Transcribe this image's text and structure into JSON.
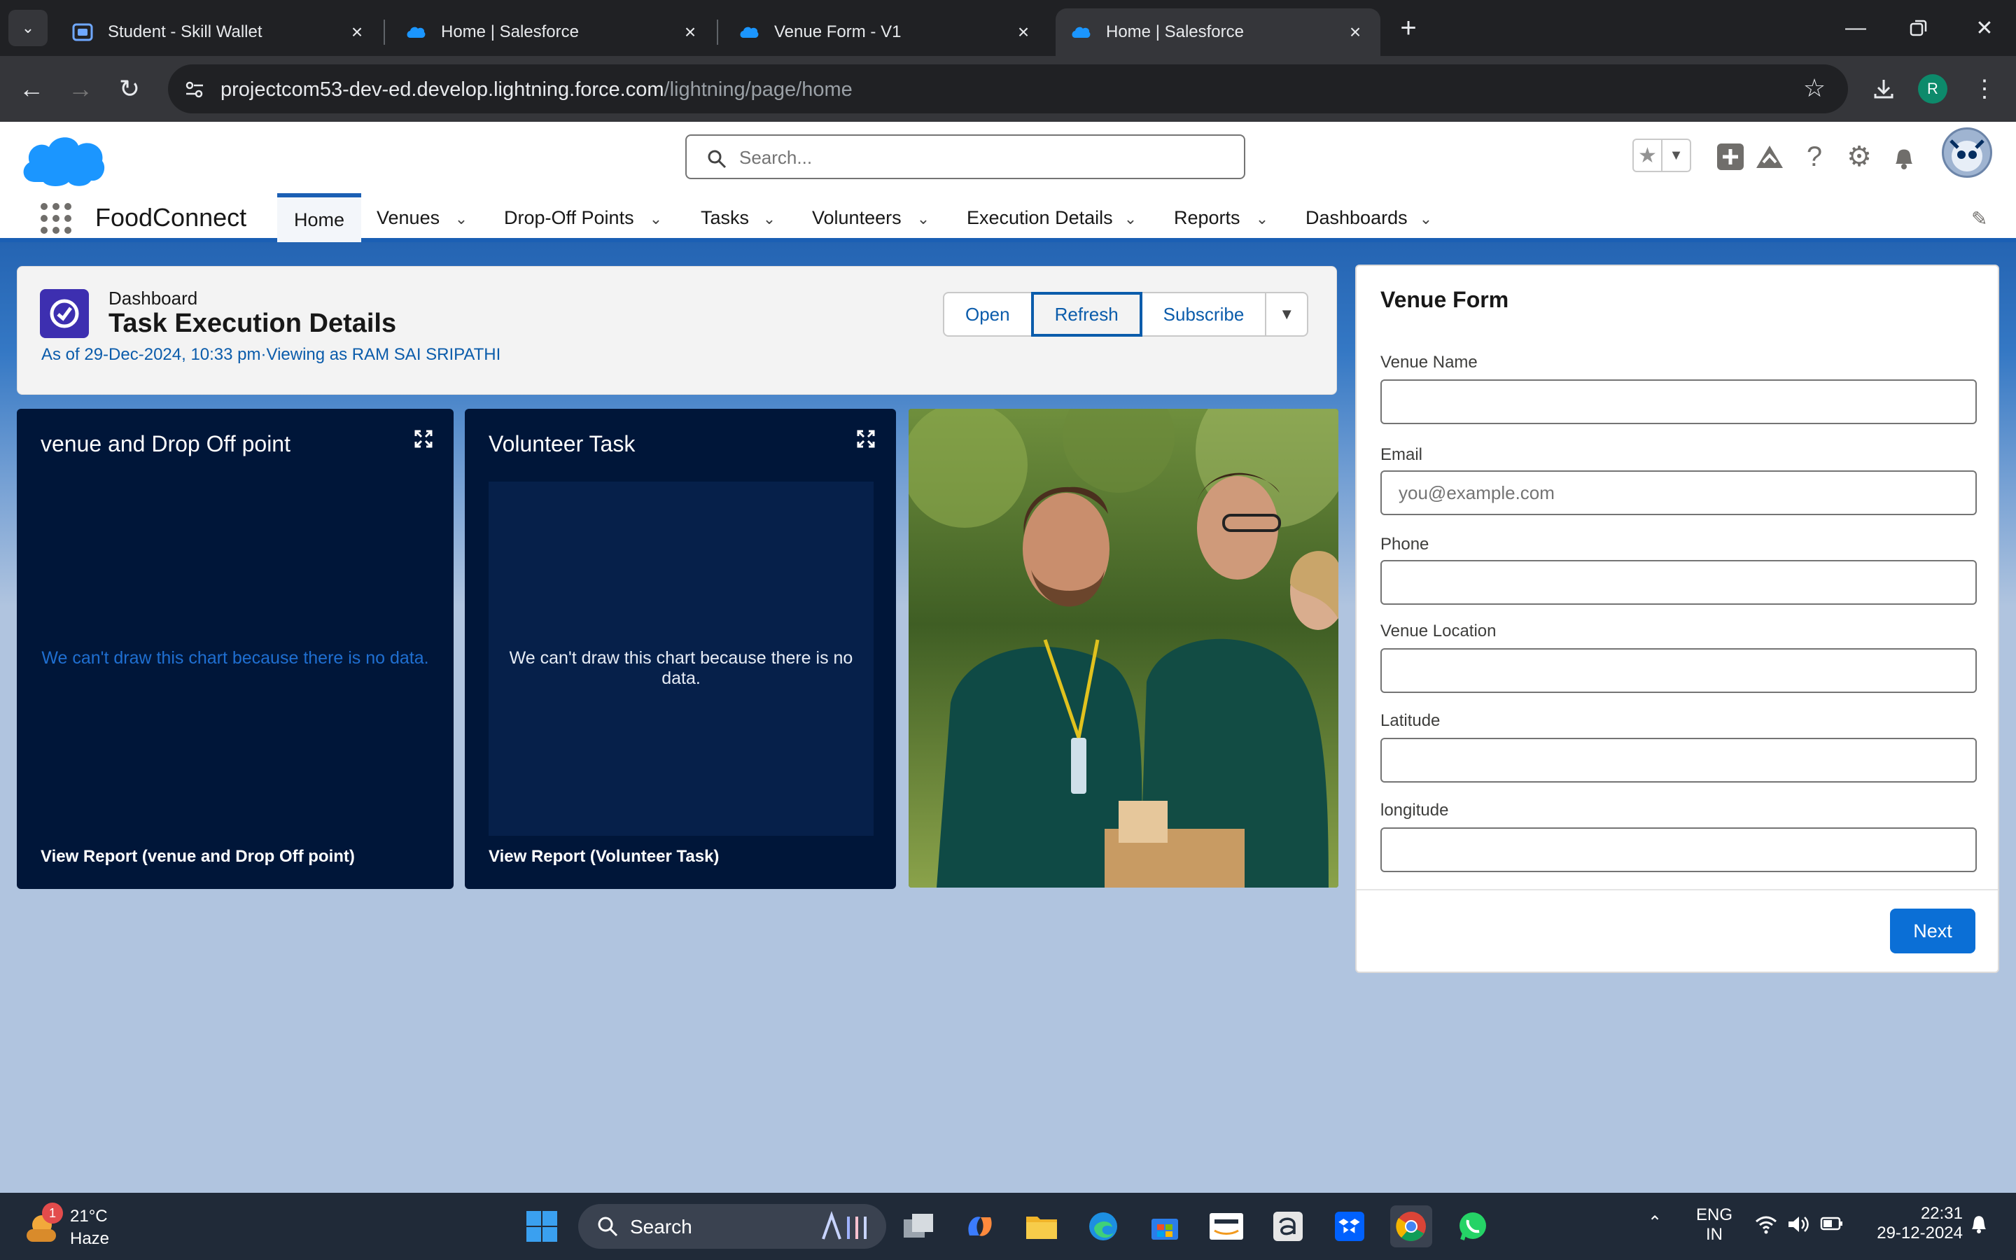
{
  "browser": {
    "tabs": [
      {
        "title": "Student - Skill Wallet",
        "active": false
      },
      {
        "title": "Home | Salesforce",
        "active": false
      },
      {
        "title": "Venue Form - V1",
        "active": false
      },
      {
        "title": "Home | Salesforce",
        "active": true
      }
    ],
    "url_domain": "projectcom53-dev-ed.develop.lightning.force.com",
    "url_path": "/lightning/page/home",
    "profile_initial": "R"
  },
  "header": {
    "search_placeholder": "Search..."
  },
  "nav": {
    "app_name": "FoodConnect",
    "items": [
      {
        "label": "Home",
        "active": true
      },
      {
        "label": "Venues"
      },
      {
        "label": "Drop-Off Points"
      },
      {
        "label": "Tasks"
      },
      {
        "label": "Volunteers"
      },
      {
        "label": "Execution Details"
      },
      {
        "label": "Reports"
      },
      {
        "label": "Dashboards"
      }
    ]
  },
  "dashboard": {
    "type_label": "Dashboard",
    "title": "Task Execution Details",
    "subtitle": "As of 29-Dec-2024, 10:33 pm·Viewing as RAM SAI SRIPATHI",
    "buttons": {
      "open": "Open",
      "refresh": "Refresh",
      "subscribe": "Subscribe"
    },
    "components": [
      {
        "title": "venue and Drop Off point",
        "no_data": "We can't draw this chart because there is no data.",
        "view_report": "View Report (venue and Drop Off point)"
      },
      {
        "title": "Volunteer Task",
        "no_data": "We can't draw this chart because there is no data.",
        "view_report": "View Report (Volunteer Task)"
      }
    ]
  },
  "venue_form": {
    "title": "Venue Form",
    "fields": [
      {
        "label": "Venue Name",
        "value": "",
        "placeholder": ""
      },
      {
        "label": "Email",
        "value": "",
        "placeholder": "you@example.com"
      },
      {
        "label": "Phone",
        "value": "",
        "placeholder": ""
      },
      {
        "label": "Venue Location",
        "value": "",
        "placeholder": ""
      },
      {
        "label": "Latitude",
        "value": "",
        "placeholder": ""
      },
      {
        "label": "longitude",
        "value": "",
        "placeholder": ""
      }
    ],
    "next_label": "Next"
  },
  "taskbar": {
    "weather_temp": "21°C",
    "weather_cond": "Haze",
    "weather_badge": "1",
    "search_label": "Search",
    "lang_top": "ENG",
    "lang_bottom": "IN",
    "time": "22:31",
    "date": "29-12-2024"
  },
  "colors": {
    "brand_blue": "#0b5cab",
    "nav_accent": "#1b5fb4",
    "chart_bg": "#001639",
    "next_button": "#0b6fd6"
  }
}
